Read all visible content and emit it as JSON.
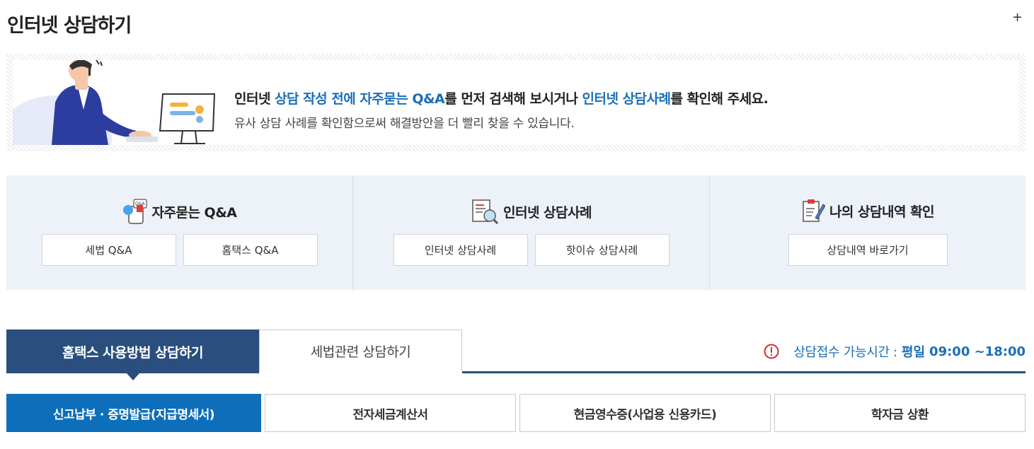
{
  "page": {
    "title": "인터넷 상담하기",
    "expand_label": "+"
  },
  "banner": {
    "line1": [
      {
        "text": "인터넷 ",
        "highlight": false
      },
      {
        "text": "상담 작성 전에 자주묻는 Q&A",
        "highlight": true
      },
      {
        "text": "를 먼저 검색해 보시거나 ",
        "highlight": false
      },
      {
        "text": "인터넷 상담사례",
        "highlight": true
      },
      {
        "text": "를 확인해 주세요.",
        "highlight": false
      }
    ],
    "line2": "유사 상담 사례를 확인함으로써 해결방안을 더 빨리 찾을 수 있습니다."
  },
  "quick_sections": [
    {
      "label": "자주묻는 Q&A",
      "icon": "qna-icon",
      "buttons": [
        "세법 Q&A",
        "홈택스 Q&A"
      ]
    },
    {
      "label": "인터넷 상담사례",
      "icon": "document-search-icon",
      "buttons": [
        "인터넷 상담사례",
        "핫이슈 상담사례"
      ]
    },
    {
      "label": "나의 상담내역 확인",
      "icon": "clipboard-pen-icon",
      "buttons": [
        "상담내역 바로가기"
      ]
    }
  ],
  "main_tabs": [
    "홈택스 사용방법 상담하기",
    "세법관련 상담하기"
  ],
  "notice": {
    "icon": "alert-icon",
    "label": "상담접수 가능시간 :",
    "day": "평일",
    "time": "09:00 ~18:00"
  },
  "sub_tabs": [
    "신고납부 · 증명발급(지급명세서)",
    "전자세금계산서",
    "현금영수증(사업용 신용카드)",
    "학자금 상환"
  ],
  "colors": {
    "primary_navy": "#2a4f7e",
    "accent_blue": "#1a6fb9",
    "active_blue": "#0d6fbb",
    "panel_bg": "#edf1f8",
    "alert_red": "#d62b2b"
  }
}
